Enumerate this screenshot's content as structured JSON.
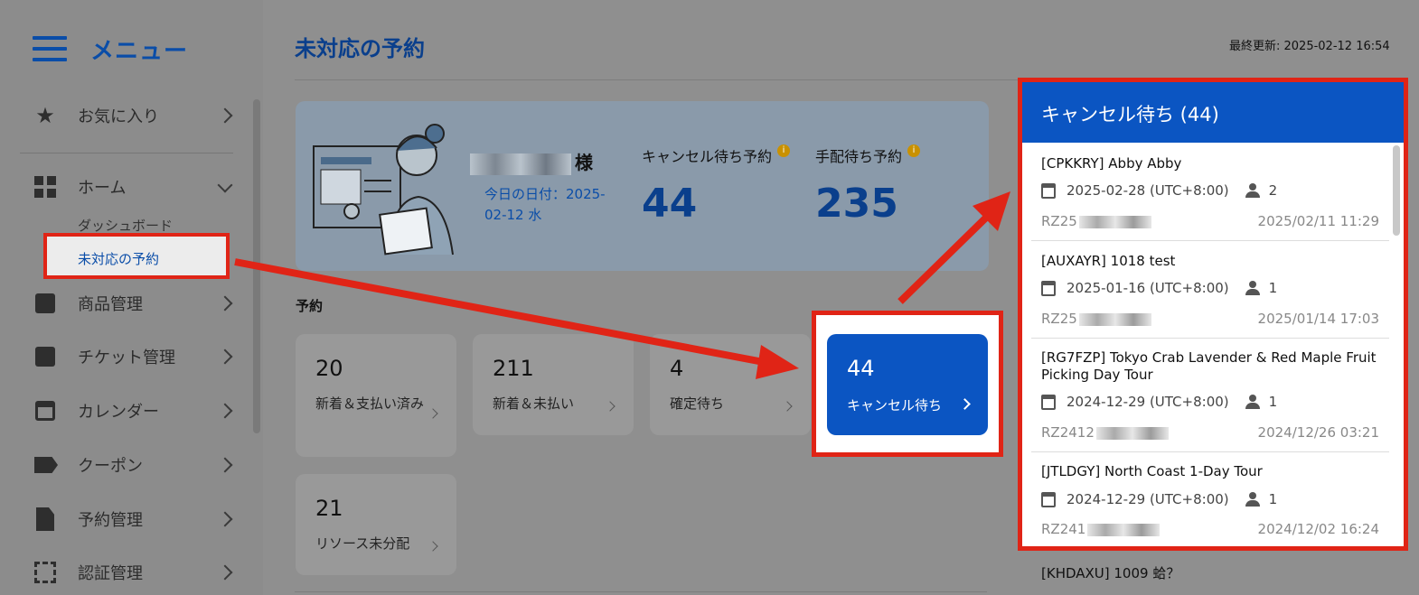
{
  "sidebar": {
    "title": "メニュー",
    "items": [
      {
        "label": "お気に入り",
        "icon": "star-icon"
      },
      {
        "label": "ホーム",
        "icon": "dashboard-icon"
      },
      {
        "label": "商品管理",
        "icon": "folder-star-icon"
      },
      {
        "label": "チケット管理",
        "icon": "ticket-icon"
      },
      {
        "label": "カレンダー",
        "icon": "calendar-icon"
      },
      {
        "label": "クーポン",
        "icon": "label-icon"
      },
      {
        "label": "予約管理",
        "icon": "document-icon"
      },
      {
        "label": "認証管理",
        "icon": "scan-icon"
      }
    ],
    "home_sub": {
      "dashboard": "ダッシュボード",
      "pending": "未対応の予約"
    }
  },
  "header": {
    "title": "未対応の予約",
    "last_updated": "最終更新: 2025-02-12 16:54"
  },
  "welcome": {
    "user_suffix": "様",
    "today": "今日の日付：2025-02-12 水",
    "cancel_label": "キャンセル待ち予約",
    "cancel_count": "44",
    "arrange_label": "手配待ち予約",
    "arrange_count": "235"
  },
  "reservations": {
    "section_label": "予約",
    "cards": [
      {
        "count": "20",
        "label": "新着＆支払い済み"
      },
      {
        "count": "211",
        "label": "新着＆未払い"
      },
      {
        "count": "4",
        "label": "確定待ち"
      },
      {
        "count": "21",
        "label": "リソース未分配"
      }
    ],
    "active_card": {
      "count": "44",
      "label": "キャンセル待ち"
    }
  },
  "panel": {
    "title": "キャンセル待ち (44)",
    "items": [
      {
        "title": "[CPKKRY] Abby Abby",
        "date": "2025-02-28 (UTC+8:00)",
        "people": "2",
        "code": "RZ25",
        "timestamp": "2025/02/11 11:29"
      },
      {
        "title": "[AUXAYR] 1018 test",
        "date": "2025-01-16 (UTC+8:00)",
        "people": "1",
        "code": "RZ25",
        "timestamp": "2025/01/14 17:03"
      },
      {
        "title": "[RG7FZP] Tokyo Crab Lavender & Red Maple Fruit Picking Day Tour",
        "date": "2024-12-29 (UTC+8:00)",
        "people": "1",
        "code": "RZ2412",
        "timestamp": "2024/12/26 03:21"
      },
      {
        "title": "[JTLDGY] North Coast 1-Day Tour",
        "date": "2024-12-29 (UTC+8:00)",
        "people": "1",
        "code": "RZ241",
        "timestamp": "2024/12/02 16:24"
      }
    ],
    "next_item_title": "[KHDAXU] 1009 蛤？"
  },
  "colors": {
    "brand_blue": "#0b55c2",
    "highlight_red": "#e02416"
  }
}
